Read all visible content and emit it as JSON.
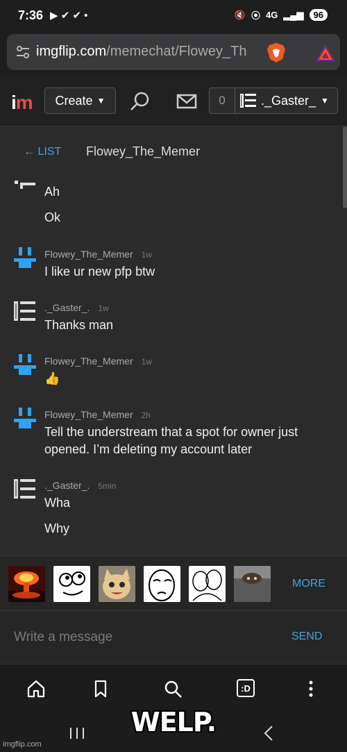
{
  "status_bar": {
    "time": "7:36",
    "network": "4G",
    "battery": "96"
  },
  "browser": {
    "url_domain": "imgflip.com",
    "url_path": "/memechat/Flowey_Th"
  },
  "site_header": {
    "logo": "im",
    "create_label": "Create",
    "notification_count": "0",
    "username": "._Gaster_"
  },
  "chat": {
    "back_label": "← LIST",
    "partner": "Flowey_The_Memer",
    "messages": [
      {
        "author": "",
        "time": "",
        "lines": [
          "Ah",
          "Ok"
        ]
      },
      {
        "author": "Flowey_The_Memer",
        "time": "1w",
        "lines": [
          "I like ur new pfp btw"
        ]
      },
      {
        "author": "._Gaster_.",
        "time": "1w",
        "lines": [
          "Thanks man"
        ]
      },
      {
        "author": "Flowey_The_Memer",
        "time": "1w",
        "lines": [
          "👍"
        ]
      },
      {
        "author": "Flowey_The_Memer",
        "time": "2h",
        "lines": [
          "Tell the understream that a spot for owner just opened. I’m deleting my account later"
        ]
      },
      {
        "author": "._Gaster_.",
        "time": "5min",
        "lines": [
          "Wha",
          "Why"
        ]
      }
    ]
  },
  "picker": {
    "thumbs": [
      "explosion",
      "derp-face",
      "smiling-cat",
      "okay-face",
      "wojak-hug",
      "ceiling-cat"
    ],
    "more_label": "MORE"
  },
  "composer": {
    "placeholder": "Write a message",
    "send_label": "SEND"
  },
  "bottom_nav": {
    "icons": [
      "home-icon",
      "bookmark-icon",
      "search-icon",
      "tabs-icon",
      "more-vertical-icon"
    ],
    "tabs_label": ":D"
  },
  "overlay": {
    "caption": "WELP.",
    "watermark": "imgflip.com"
  },
  "colors": {
    "accent": "#3aa8e0",
    "background": "#2b2b2b",
    "logo_m": "#e54b4b"
  }
}
